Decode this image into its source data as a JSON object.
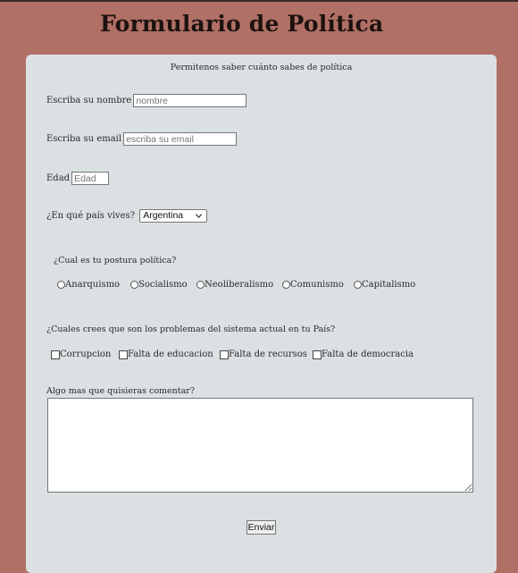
{
  "header": {
    "title": "Formulario de Política"
  },
  "form": {
    "subtitle": "Permitenos saber cuánto sabes de política",
    "name": {
      "label": "Escriba su nombre",
      "placeholder": "nombre",
      "value": ""
    },
    "email": {
      "label": "Escriba su email",
      "placeholder": "escriba su email",
      "value": ""
    },
    "age": {
      "label": "Edad",
      "placeholder": "Edad",
      "value": ""
    },
    "country": {
      "label": "¿En qué país vives?",
      "selected": "Argentina"
    },
    "posture": {
      "question": "¿Cual es tu postura política?",
      "options": [
        "Anarquismo",
        "Socialismo",
        "Neoliberalismo",
        "Comunismo",
        "Capitalismo"
      ]
    },
    "problems": {
      "question": "¿Cuales crees que son los problemas del sistema actual en tu País?",
      "options": [
        "Corrupcion",
        "Falta de educacion",
        "Falta de recursos",
        "Falta de democracia"
      ]
    },
    "comments": {
      "label": "Algo mas que quisieras comentar?",
      "value": ""
    },
    "submit_label": "Enviar"
  },
  "icons": {
    "select_arrow": "chevron-down-icon"
  }
}
